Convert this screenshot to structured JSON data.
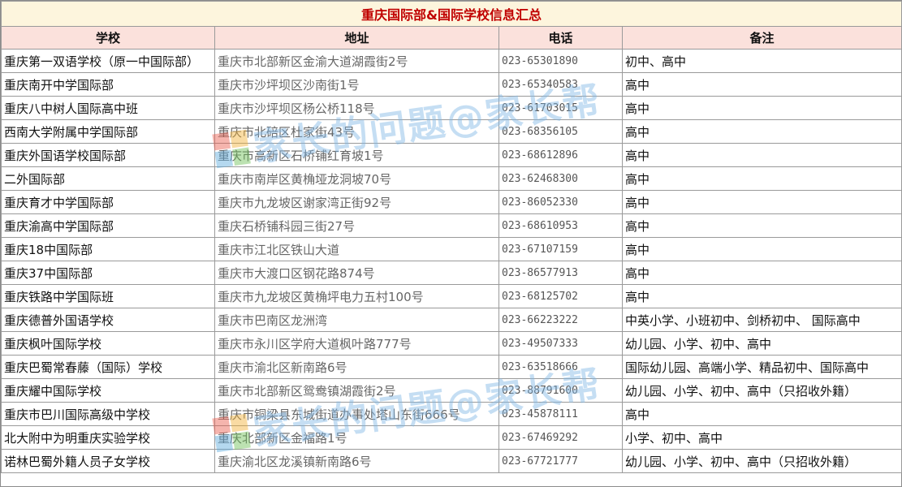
{
  "title": "重庆国际部&国际学校信息汇总",
  "headers": {
    "school": "学校",
    "address": "地址",
    "phone": "电话",
    "note": "备注"
  },
  "rows": [
    {
      "school": "重庆第一双语学校（原一中国际部）",
      "address": "重庆市北部新区金渝大道湖霞街2号",
      "phone": "023-65301890",
      "note": "初中、高中"
    },
    {
      "school": "重庆南开中学国际部",
      "address": "重庆市沙坪坝区沙南街1号",
      "phone": "023-65340583",
      "note": "高中"
    },
    {
      "school": "重庆八中树人国际高中班",
      "address": "重庆市沙坪坝区杨公桥118号",
      "phone": "023-61703015",
      "note": "高中"
    },
    {
      "school": "西南大学附属中学国际部",
      "address": "重庆市北碚区杜家街43号",
      "phone": "023-68356105",
      "note": "高中"
    },
    {
      "school": "重庆外国语学校国际部",
      "address": "重庆市高新区石桥铺红育坡1号",
      "phone": "023-68612896",
      "note": "高中"
    },
    {
      "school": "二外国际部",
      "address": "重庆市南岸区黄桷垭龙洞坡70号",
      "phone": "023-62468300",
      "note": "高中"
    },
    {
      "school": "重庆育才中学国际部",
      "address": "重庆市九龙坡区谢家湾正街92号",
      "phone": "023-86052330",
      "note": "高中"
    },
    {
      "school": "重庆渝高中学国际部",
      "address": "重庆石桥铺科园三街27号",
      "phone": "023-68610953",
      "note": "高中"
    },
    {
      "school": "重庆18中国际部",
      "address": "重庆市江北区铁山大道",
      "phone": "023-67107159",
      "note": "高中"
    },
    {
      "school": "重庆37中国际部",
      "address": "重庆市大渡口区钢花路874号",
      "phone": "023-86577913",
      "note": "高中"
    },
    {
      "school": "重庆铁路中学国际班",
      "address": "重庆市九龙坡区黄桷坪电力五村100号",
      "phone": "023-68125702",
      "note": "高中"
    },
    {
      "school": "重庆德普外国语学校",
      "address": "重庆市巴南区龙洲湾",
      "phone": "023-66223222",
      "note": "中英小学、小班初中、剑桥初中、  国际高中"
    },
    {
      "school": "重庆枫叶国际学校",
      "address": "重庆市永川区学府大道枫叶路777号",
      "phone": "023-49507333",
      "note": "幼儿园、小学、初中、高中"
    },
    {
      "school": "重庆巴蜀常春藤（国际）学校",
      "address": "重庆市渝北区新南路6号",
      "phone": "023-63518666",
      "note": "国际幼儿园、高端小学、精品初中、国际高中"
    },
    {
      "school": "重庆耀中国际学校",
      "address": "重庆市北部新区鸳鸯镇湖霞街2号",
      "phone": "023-88791600",
      "note": "幼儿园、小学、初中、高中（只招收外籍）"
    },
    {
      "school": "重庆市巴川国际高级中学校",
      "address": "重庆市铜梁县东城街道办事处塔山东街666号",
      "phone": "023-45878111",
      "note": "高中"
    },
    {
      "school": "北大附中为明重庆实验学校",
      "address": "重庆北部新区金福路1号",
      "phone": "023-67469292",
      "note": "小学、初中、高中"
    },
    {
      "school": "诺林巴蜀外籍人员子女学校",
      "address": "重庆渝北区龙溪镇新南路6号",
      "phone": "023-67721777",
      "note": "幼儿园、小学、初中、高中（只招收外籍）"
    }
  ],
  "watermark": {
    "text": "家长的问题@家长帮",
    "icon": "colorful-square-logo"
  },
  "colors": {
    "title_bg": "#fdf5dd",
    "title_text": "#c00000",
    "header_bg": "#fbe1dc",
    "watermark": "#7fb7e6"
  }
}
